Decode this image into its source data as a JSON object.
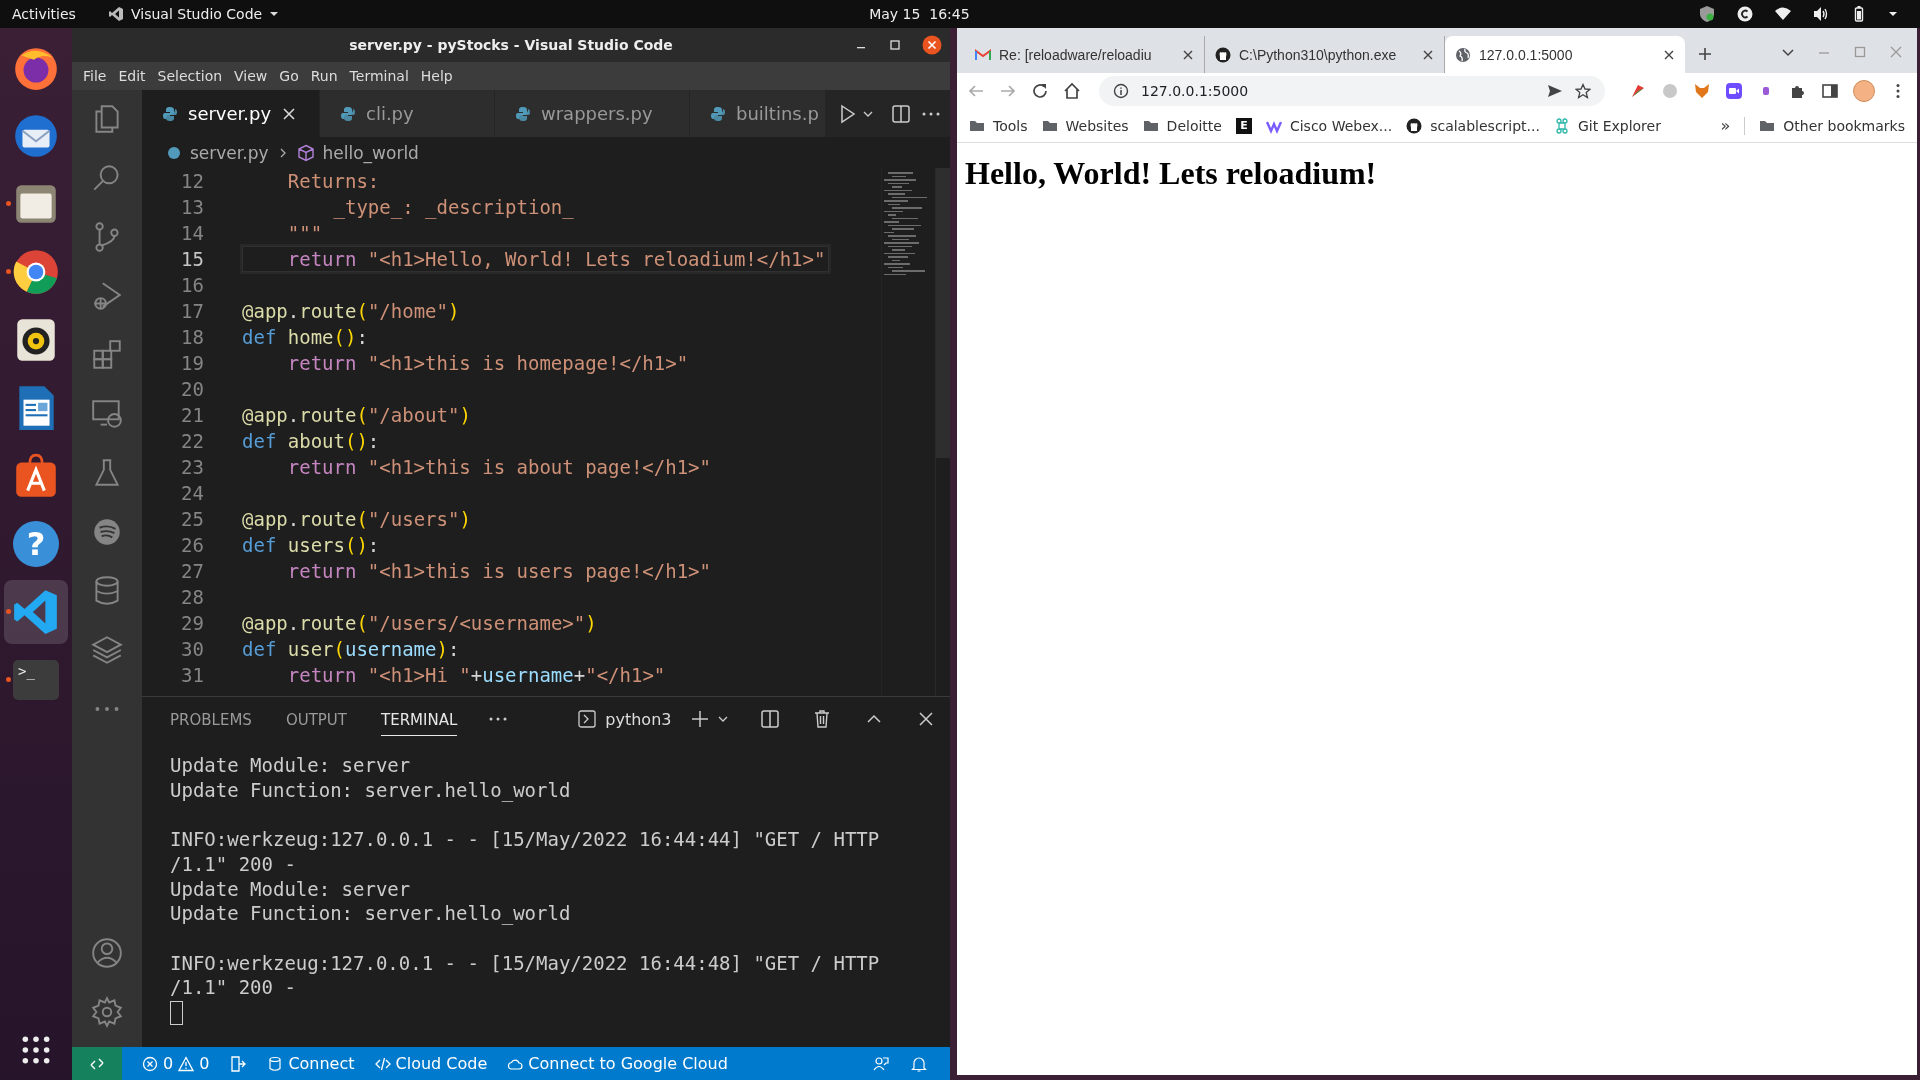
{
  "top_bar": {
    "activities": "Activities",
    "app_menu": "Visual Studio Code",
    "clock": "May 15  16:45"
  },
  "dock": [
    {
      "kind": "firefox",
      "running": false,
      "selected": false
    },
    {
      "kind": "thunderbird",
      "running": false,
      "selected": false
    },
    {
      "kind": "files",
      "running": true,
      "selected": false
    },
    {
      "kind": "chrome",
      "running": true,
      "selected": false
    },
    {
      "kind": "rhythmbox",
      "running": false,
      "selected": false
    },
    {
      "kind": "writer",
      "running": false,
      "selected": false
    },
    {
      "kind": "software",
      "running": false,
      "selected": false
    },
    {
      "kind": "help",
      "glyph": "?",
      "running": false,
      "selected": false
    },
    {
      "kind": "vscode",
      "running": true,
      "selected": true
    },
    {
      "kind": "terminal",
      "glyph": ">_",
      "running": true,
      "selected": false
    }
  ],
  "vscode": {
    "title": "server.py - pyStocks - Visual Studio Code",
    "menu": [
      "File",
      "Edit",
      "Selection",
      "View",
      "Go",
      "Run",
      "Terminal",
      "Help"
    ],
    "activity_bar": [
      {
        "kind": "explorer"
      },
      {
        "kind": "search"
      },
      {
        "kind": "source-control"
      },
      {
        "kind": "run-debug"
      },
      {
        "kind": "extensions"
      },
      {
        "kind": "remote"
      },
      {
        "kind": "testing"
      },
      {
        "kind": "spotify"
      },
      {
        "kind": "database"
      },
      {
        "kind": "layers"
      },
      {
        "kind": "more"
      },
      {
        "kind": "account"
      },
      {
        "kind": "settings"
      }
    ],
    "tabs": [
      {
        "label": "server.py",
        "selected": true
      },
      {
        "label": "cli.py",
        "selected": false
      },
      {
        "label": "wrappers.py",
        "selected": false
      },
      {
        "label": "builtins.p",
        "selected": false
      }
    ],
    "breadcrumb": {
      "file": "server.py",
      "symbol": "hello_world"
    },
    "code": [
      {
        "number": "12",
        "current": false,
        "tokens": [
          {
            "kind": "string",
            "text": "    Returns:"
          }
        ]
      },
      {
        "number": "13",
        "current": false,
        "tokens": [
          {
            "kind": "string",
            "text": "        _type_: _description_"
          }
        ]
      },
      {
        "number": "14",
        "current": false,
        "tokens": [
          {
            "kind": "string",
            "text": "    \"\"\""
          }
        ]
      },
      {
        "number": "15",
        "current": true,
        "tokens": [
          {
            "kind": "control",
            "text": "    return"
          },
          {
            "kind": "string",
            "text": " \"<h1>Hello, World! Lets reloadium!</h1>\""
          }
        ]
      },
      {
        "number": "16",
        "current": false
      },
      {
        "number": "17",
        "current": false,
        "tokens": [
          {
            "kind": "func",
            "text": "@app"
          },
          {
            "kind": "plain",
            "text": "."
          },
          {
            "kind": "func",
            "text": "route"
          },
          {
            "kind": "paren",
            "text": "("
          },
          {
            "kind": "string",
            "text": "\"/home\""
          },
          {
            "kind": "paren",
            "text": ")"
          }
        ]
      },
      {
        "number": "18",
        "current": false,
        "tokens": [
          {
            "kind": "keyword",
            "text": "def "
          },
          {
            "kind": "func",
            "text": "home"
          },
          {
            "kind": "paren",
            "text": "()"
          },
          {
            "kind": "plain",
            "text": ":"
          }
        ]
      },
      {
        "number": "19",
        "current": false,
        "tokens": [
          {
            "kind": "control",
            "text": "    return"
          },
          {
            "kind": "string",
            "text": " \"<h1>this is homepage!</h1>\""
          }
        ]
      },
      {
        "number": "20",
        "current": false
      },
      {
        "number": "21",
        "current": false,
        "tokens": [
          {
            "kind": "func",
            "text": "@app"
          },
          {
            "kind": "plain",
            "text": "."
          },
          {
            "kind": "func",
            "text": "route"
          },
          {
            "kind": "paren",
            "text": "("
          },
          {
            "kind": "string",
            "text": "\"/about\""
          },
          {
            "kind": "paren",
            "text": ")"
          }
        ]
      },
      {
        "number": "22",
        "current": false,
        "tokens": [
          {
            "kind": "keyword",
            "text": "def "
          },
          {
            "kind": "func",
            "text": "about"
          },
          {
            "kind": "paren",
            "text": "()"
          },
          {
            "kind": "plain",
            "text": ":"
          }
        ]
      },
      {
        "number": "23",
        "current": false,
        "tokens": [
          {
            "kind": "control",
            "text": "    return"
          },
          {
            "kind": "string",
            "text": " \"<h1>this is about page!</h1>\""
          }
        ]
      },
      {
        "number": "24",
        "current": false
      },
      {
        "number": "25",
        "current": false,
        "tokens": [
          {
            "kind": "func",
            "text": "@app"
          },
          {
            "kind": "plain",
            "text": "."
          },
          {
            "kind": "func",
            "text": "route"
          },
          {
            "kind": "paren",
            "text": "("
          },
          {
            "kind": "string",
            "text": "\"/users\""
          },
          {
            "kind": "paren",
            "text": ")"
          }
        ]
      },
      {
        "number": "26",
        "current": false,
        "tokens": [
          {
            "kind": "keyword",
            "text": "def "
          },
          {
            "kind": "func",
            "text": "users"
          },
          {
            "kind": "paren",
            "text": "()"
          },
          {
            "kind": "plain",
            "text": ":"
          }
        ]
      },
      {
        "number": "27",
        "current": false,
        "tokens": [
          {
            "kind": "control",
            "text": "    return"
          },
          {
            "kind": "string",
            "text": " \"<h1>this is users page!</h1>\""
          }
        ]
      },
      {
        "number": "28",
        "current": false
      },
      {
        "number": "29",
        "current": false,
        "tokens": [
          {
            "kind": "func",
            "text": "@app"
          },
          {
            "kind": "plain",
            "text": "."
          },
          {
            "kind": "func",
            "text": "route"
          },
          {
            "kind": "paren",
            "text": "("
          },
          {
            "kind": "string",
            "text": "\"/users/<username>\""
          },
          {
            "kind": "paren",
            "text": ")"
          }
        ]
      },
      {
        "number": "30",
        "current": false,
        "tokens": [
          {
            "kind": "keyword",
            "text": "def "
          },
          {
            "kind": "func",
            "text": "user"
          },
          {
            "kind": "paren",
            "text": "("
          },
          {
            "kind": "variable",
            "text": "username"
          },
          {
            "kind": "paren",
            "text": ")"
          },
          {
            "kind": "plain",
            "text": ":"
          }
        ]
      },
      {
        "number": "31",
        "current": false,
        "tokens": [
          {
            "kind": "control",
            "text": "    return"
          },
          {
            "kind": "string",
            "text": " \"<h1>Hi \""
          },
          {
            "kind": "plain",
            "text": "+"
          },
          {
            "kind": "variable",
            "text": "username"
          },
          {
            "kind": "plain",
            "text": "+"
          },
          {
            "kind": "string",
            "text": "\"</h1>\""
          }
        ]
      }
    ],
    "panel": {
      "tabs": [
        {
          "label": "PROBLEMS",
          "selected": false
        },
        {
          "label": "OUTPUT",
          "selected": false
        },
        {
          "label": "TERMINAL",
          "selected": true
        }
      ],
      "shell": "python3",
      "terminal": [
        [
          "Update Module: server",
          "Update Function: server.hello_world"
        ],
        [
          "INFO:werkzeug:127.0.0.1 - - [15/May/2022 16:44:44] \"GET / HTTP",
          "/1.1\" 200 -",
          "Update Module: server",
          "Update Function: server.hello_world"
        ],
        [
          "INFO:werkzeug:127.0.0.1 - - [15/May/2022 16:44:48] \"GET / HTTP",
          "/1.1\" 200 -"
        ]
      ]
    },
    "status_bar": {
      "errors": "0",
      "warnings": "0",
      "items": [
        {
          "kind": "database",
          "label": "Connect"
        },
        {
          "kind": "code",
          "label": "Cloud Code"
        },
        {
          "kind": "cloud",
          "label": "Connect to Google Cloud"
        }
      ]
    }
  },
  "browser": {
    "tabs": [
      {
        "kind": "mail",
        "title": "Re: [reloadware/reloadiu",
        "selected": false
      },
      {
        "kind": "github",
        "title": "C:\\Python310\\python.exe",
        "selected": false
      },
      {
        "kind": "globe",
        "title": "127.0.0.1:5000",
        "selected": true
      }
    ],
    "address": "127.0.0.1:5000",
    "bookmarks": [
      {
        "kind": "folder",
        "label": "Tools"
      },
      {
        "kind": "folder",
        "label": "Websites"
      },
      {
        "kind": "folder",
        "label": "Deloitte"
      },
      {
        "kind": "letter",
        "glyph": "E"
      },
      {
        "kind": "webex",
        "label": "Cisco Webex..."
      },
      {
        "kind": "github",
        "label": "scalablescript..."
      },
      {
        "kind": "git",
        "label": "Git Explorer"
      }
    ],
    "overflow": "»",
    "other_bookmarks": "Other bookmarks",
    "heading": "Hello, World! Lets reloadium!"
  }
}
